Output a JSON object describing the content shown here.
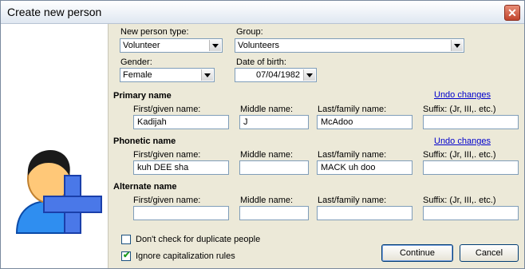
{
  "window": {
    "title": "Create new person",
    "close_glyph": "✕"
  },
  "fields": {
    "new_person_type": {
      "label": "New person type:",
      "value": "Volunteer"
    },
    "group": {
      "label": "Group:",
      "value": "Volunteers"
    },
    "gender": {
      "label": "Gender:",
      "value": "Female"
    },
    "dob": {
      "label": "Date of birth:",
      "value": "07/04/1982"
    }
  },
  "sections": {
    "primary": {
      "title": "Primary name",
      "undo": "Undo changes",
      "first_label": "First/given name:",
      "middle_label": "Middle name:",
      "last_label": "Last/family name:",
      "suffix_label": "Suffix: (Jr, III,. etc.)",
      "first_value": "Kadijah",
      "middle_value": "J",
      "last_value": "McAdoo",
      "suffix_value": ""
    },
    "phonetic": {
      "title": "Phonetic name",
      "undo": "Undo changes",
      "first_label": "First/given name:",
      "middle_label": "Middle name:",
      "last_label": "Last/family name:",
      "suffix_label": "Suffix: (Jr, III,. etc.)",
      "first_value": "kuh DEE sha",
      "middle_value": "",
      "last_value": "MACK uh doo",
      "suffix_value": ""
    },
    "alternate": {
      "title": "Alternate name",
      "first_label": "First/given name:",
      "middle_label": "Middle name:",
      "last_label": "Last/family name:",
      "suffix_label": "Suffix: (Jr, III,. etc.)",
      "first_value": "",
      "middle_value": "",
      "last_value": "",
      "suffix_value": ""
    }
  },
  "options": {
    "no_dup_check": {
      "label": "Don't check for duplicate people",
      "checked": false
    },
    "ignore_caps": {
      "label": "Ignore capitalization rules",
      "checked": true
    }
  },
  "buttons": {
    "continue": "Continue",
    "cancel": "Cancel"
  },
  "icons": {
    "person": "add-person-icon"
  },
  "colors": {
    "link": "#0000cc",
    "accent_blue": "#2a6de0",
    "close_red": "#c1452d"
  }
}
